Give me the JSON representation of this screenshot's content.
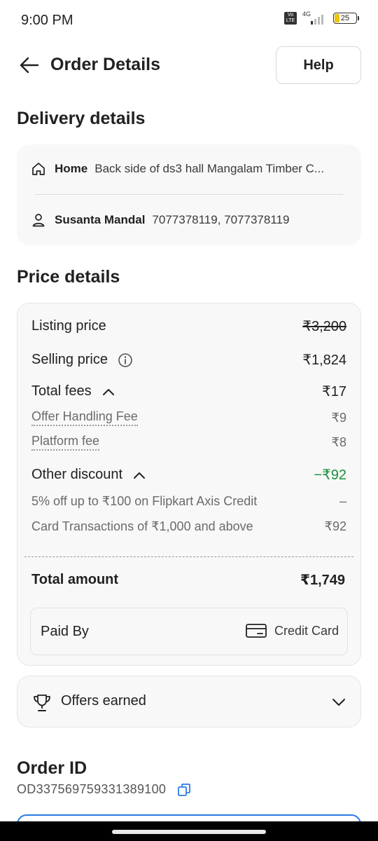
{
  "status_bar": {
    "time": "9:00 PM",
    "volte": "Vo LTE",
    "network": "4G",
    "battery": "25",
    "battery_level": 0.25
  },
  "header": {
    "title": "Order Details",
    "help_label": "Help",
    "back_icon": "arrow-left-icon"
  },
  "delivery": {
    "section_title": "Delivery details",
    "address_label": "Home",
    "address_value": "Back side of ds3 hall Mangalam Timber C...",
    "contact_label": "Susanta Mandal",
    "contact_value": "7077378119, 7077378119"
  },
  "price": {
    "section_title": "Price details",
    "listing_label": "Listing price",
    "listing_value": "₹3,200",
    "selling_label": "Selling price",
    "selling_value": "₹1,824",
    "fees_label": "Total fees",
    "fees_value": "₹17",
    "fee_items": [
      {
        "label": "Offer Handling Fee",
        "value": "₹9"
      },
      {
        "label": "Platform fee",
        "value": "₹8"
      }
    ],
    "discount_label": "Other discount",
    "discount_value": "−₹92",
    "discount_items": [
      {
        "label": "5% off up to ₹100 on Flipkart Axis Credit",
        "value": "–"
      },
      {
        "label": "Card Transactions of ₹1,000 and above",
        "value": "₹92"
      }
    ],
    "total_label": "Total amount",
    "total_value": "₹1,749",
    "paid_by_label": "Paid By",
    "paid_method": "Credit Card"
  },
  "offers": {
    "label": "Offers earned"
  },
  "order": {
    "section_title": "Order ID",
    "id": "OD337569759331389100"
  },
  "colors": {
    "discount_green": "#1a8f3a",
    "accent_blue": "#2a7de1",
    "card_bg": "#f8f8f8"
  }
}
